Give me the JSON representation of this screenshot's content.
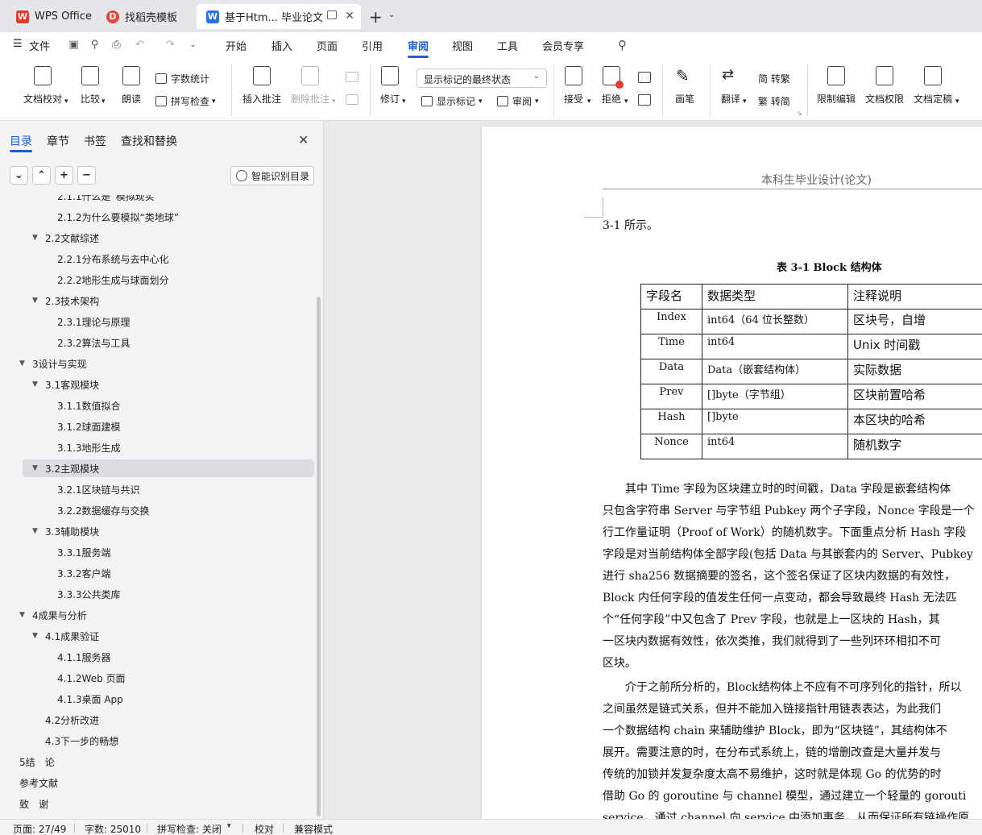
{
  "tabs": [
    {
      "label": "WPS Office",
      "logo": "W"
    },
    {
      "label": "找稻壳模板",
      "logo": "D"
    },
    {
      "label": "基于Htm... 毕业论文",
      "logo": "W"
    }
  ],
  "menu": {
    "file": "文件",
    "items": [
      "开始",
      "插入",
      "页面",
      "引用",
      "审阅",
      "视图",
      "工具",
      "会员专享"
    ],
    "active": "审阅"
  },
  "ribbon": {
    "doc_proof": "文档校对",
    "compare": "比较",
    "read_aloud": "朗读",
    "word_count": "字数统计",
    "spell_check": "拼写检查",
    "insert_comment": "插入批注",
    "delete_comment": "删除批注",
    "track_changes": "修订",
    "markup_mode": "显示标记的最终状态",
    "show_markup": "显示标记",
    "review_pane": "审阅",
    "accept": "接受",
    "reject": "拒绝",
    "ink": "画笔",
    "translate": "翻译",
    "to_traditional": "简 转繁",
    "to_simplified": "繁 转简",
    "restrict_edit": "限制编辑",
    "doc_permission": "文档权限",
    "finalize": "文档定稿"
  },
  "panel": {
    "tabs": [
      "目录",
      "章节",
      "书签",
      "查找和替换"
    ],
    "active_tab": "目录",
    "smart_toc": "智能识别目录"
  },
  "toc": [
    {
      "text": "2.1.1什么是“模拟现实”",
      "level": 3
    },
    {
      "text": "2.1.2为什么要模拟“类地球”",
      "level": 3
    },
    {
      "text": "2.2文献综述",
      "level": 2,
      "expand": true
    },
    {
      "text": "2.2.1分布系统与去中心化",
      "level": 3
    },
    {
      "text": "2.2.2地形生成与球面划分",
      "level": 3
    },
    {
      "text": "2.3技术架构",
      "level": 2,
      "expand": true
    },
    {
      "text": "2.3.1理论与原理",
      "level": 3
    },
    {
      "text": "2.3.2算法与工具",
      "level": 3
    },
    {
      "text": "3设计与实现",
      "level": 1,
      "expand": true
    },
    {
      "text": "3.1客观模块",
      "level": 2,
      "expand": true
    },
    {
      "text": "3.1.1数值拟合",
      "level": 3
    },
    {
      "text": "3.1.2球面建模",
      "level": 3
    },
    {
      "text": "3.1.3地形生成",
      "level": 3
    },
    {
      "text": "3.2主观模块",
      "level": 2,
      "expand": true,
      "selected": true
    },
    {
      "text": "3.2.1区块链与共识",
      "level": 3
    },
    {
      "text": "3.2.2数据缓存与交换",
      "level": 3
    },
    {
      "text": "3.3辅助模块",
      "level": 2,
      "expand": true
    },
    {
      "text": "3.3.1服务端",
      "level": 3
    },
    {
      "text": "3.3.2客户端",
      "level": 3
    },
    {
      "text": "3.3.3公共类库",
      "level": 3
    },
    {
      "text": "4成果与分析",
      "level": 1,
      "expand": true
    },
    {
      "text": "4.1成果验证",
      "level": 2,
      "expand": true
    },
    {
      "text": "4.1.1服务器",
      "level": 3
    },
    {
      "text": "4.1.2Web 页面",
      "level": 3
    },
    {
      "text": "4.1.3桌面 App",
      "level": 3
    },
    {
      "text": "4.2分析改进",
      "level": 2
    },
    {
      "text": "4.3下一步的畅想",
      "level": 2
    },
    {
      "text": "5结　论",
      "level": 1
    },
    {
      "text": "参考文献",
      "level": 1
    },
    {
      "text": "致　谢",
      "level": 1
    }
  ],
  "document": {
    "running_header": "本科生毕业设计(论文)",
    "continued_text": "3-1 所示。",
    "table_caption": "表 3-1  Block 结构体",
    "table_headers": [
      "字段名",
      "数据类型",
      "注释说明"
    ],
    "table_rows": [
      [
        "Index",
        "int64（64 位长整数）",
        "区块号，自增"
      ],
      [
        "Time",
        "int64",
        "Unix 时间戳"
      ],
      [
        "Data",
        "Data（嵌套结构体）",
        "实际数据"
      ],
      [
        "Prev",
        "[]byte（字节组）",
        "区块前置哈希"
      ],
      [
        "Hash",
        "[]byte",
        "本区块的哈希"
      ],
      [
        "Nonce",
        "int64",
        "随机数字"
      ]
    ],
    "para1": [
      "　　其中 Time 字段为区块建立时的时间戳，Data 字段是嵌套结构体",
      "只包含字符串 Server 与字节组 Pubkey 两个子字段，Nonce 字段是一个",
      "行工作量证明（Proof of Work）的随机数字。下面重点分析 Hash 字段",
      "字段是对当前结构体全部字段(包括 Data 与其嵌套内的 Server、Pubkey",
      "进行 sha256 数据摘要的签名，这个签名保证了区块内数据的有效性，",
      "Block 内任何字段的值发生任何一点变动，都会导致最终 Hash 无法匹",
      "个“任何字段”中又包含了 Prev 字段，也就是上一区块的 Hash，其",
      "一区块内数据有效性，依次类推，我们就得到了一些列环环相扣不可",
      "区块。"
    ],
    "para2": [
      "　　介于之前所分析的，Block结构体上不应有不可序列化的指针，所以",
      "之间虽然是链式关系，但并不能加入链接指针用链表表达，为此我们",
      "一个数据结构 chain 来辅助维护 Block，即为“区块链”，其结构体不",
      "展开。需要注意的时，在分布式系统上，链的增删改查是大量并发与",
      "传统的加锁并发复杂度太高不易维护，这时就是体现 Go 的优势的时",
      "借助 Go 的 goroutine 与 channel 模型，通过建立一个轻量的 gorouti",
      "service，通过 channel 向 service 中添加事务，从而保证所有链操作原"
    ]
  },
  "status": {
    "page": "页面: 27/49",
    "words": "字数: 25010",
    "spell": "拼写检查: 关闭",
    "proof": "校对",
    "compat": "兼容模式"
  },
  "colors": {
    "accent": "#1a5fd6",
    "wps_red": "#e33a2c"
  }
}
